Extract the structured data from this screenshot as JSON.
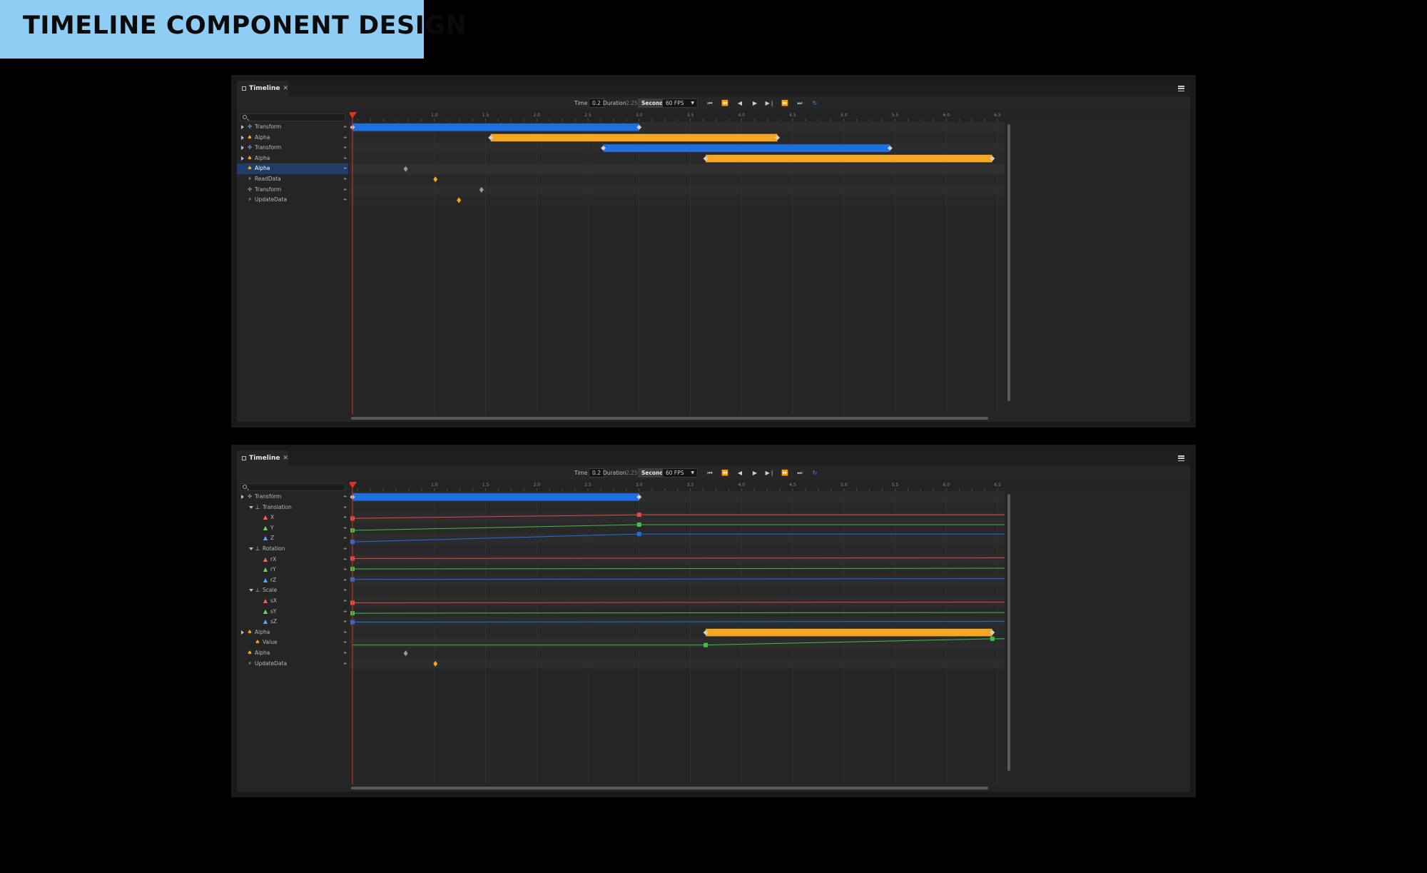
{
  "banner": {
    "title": "TIMELINE COMPONENT DESIGN"
  },
  "colors": {
    "blue_clip": "#1e6fe0",
    "orange_clip": "#f5a623",
    "playhead": "#e0301e",
    "curve_red": "#e14b4b",
    "curve_green": "#3fbf4a",
    "curve_blue": "#3c6fe0"
  },
  "panels": [
    {
      "tab_label": "Timeline",
      "toolbar": {
        "time_label": "Time",
        "time_value": "0.2",
        "duration_label": "Duration",
        "duration_value": "2.25",
        "units": "Seconds",
        "fps": "60 FPS"
      },
      "ruler_ticks": [
        "1.0",
        "1.5",
        "2.0",
        "2.5",
        "3.0",
        "3.5",
        "4.0",
        "4.5",
        "5.0",
        "5.5",
        "6.0",
        "6.5"
      ],
      "playhead_time": 0.2,
      "rows": [
        {
          "label": "Transform",
          "icon": "move-icon",
          "indent": 0,
          "caret": "right",
          "selected": false
        },
        {
          "label": "Alpha",
          "icon": "cup-icon",
          "indent": 0,
          "caret": "right",
          "selected": false
        },
        {
          "label": "Transform",
          "icon": "move-icon",
          "indent": 0,
          "caret": "right",
          "selected": false
        },
        {
          "label": "Alpha",
          "icon": "cup-icon",
          "indent": 0,
          "caret": "right",
          "selected": false
        },
        {
          "label": "Alpha",
          "icon": "cup-icon",
          "indent": 0,
          "caret": "none",
          "selected": true
        },
        {
          "label": "ReadData",
          "icon": "bolt-icon",
          "indent": 0,
          "caret": "none",
          "selected": false
        },
        {
          "label": "Transform",
          "icon": "move-icon",
          "indent": 0,
          "caret": "none",
          "selected": false
        },
        {
          "label": "UpdateData",
          "icon": "bolt-icon",
          "indent": 0,
          "caret": "none",
          "selected": false
        }
      ],
      "clips": [
        {
          "row": 0,
          "start": 0.2,
          "end": 3.0,
          "color": "blue"
        },
        {
          "row": 1,
          "start": 1.55,
          "end": 4.35,
          "color": "orange"
        },
        {
          "row": 2,
          "start": 2.65,
          "end": 5.45,
          "color": "blue"
        },
        {
          "row": 3,
          "start": 3.65,
          "end": 6.45,
          "color": "orange"
        }
      ],
      "keys": [
        {
          "row": 4,
          "time": 0.72,
          "color": "gray"
        },
        {
          "row": 5,
          "time": 1.01,
          "color": "orange"
        },
        {
          "row": 6,
          "time": 1.46,
          "color": "gray"
        },
        {
          "row": 7,
          "time": 1.24,
          "color": "orange"
        }
      ],
      "curves": []
    },
    {
      "tab_label": "Timeline",
      "toolbar": {
        "time_label": "Time",
        "time_value": "0.2",
        "duration_label": "Duration",
        "duration_value": "2.25",
        "units": "Seconds",
        "fps": "60 FPS"
      },
      "ruler_ticks": [
        "1.0",
        "1.5",
        "2.0",
        "2.5",
        "3.0",
        "3.5",
        "4.0",
        "4.5",
        "5.0",
        "5.5",
        "6.0",
        "6.5"
      ],
      "playhead_time": 0.2,
      "rows": [
        {
          "label": "Transform",
          "icon": "move-icon",
          "indent": 0,
          "caret": "right",
          "selected": false
        },
        {
          "label": "Translation",
          "icon": "axes-icon",
          "indent": 1,
          "caret": "down",
          "selected": false
        },
        {
          "label": "X",
          "icon": "tri-red-icon",
          "indent": 2,
          "caret": "none",
          "selected": false
        },
        {
          "label": "Y",
          "icon": "tri-green-icon",
          "indent": 2,
          "caret": "none",
          "selected": false
        },
        {
          "label": "Z",
          "icon": "tri-blue-icon",
          "indent": 2,
          "caret": "none",
          "selected": false
        },
        {
          "label": "Rotation",
          "icon": "axes-icon",
          "indent": 1,
          "caret": "down",
          "selected": false
        },
        {
          "label": "rX",
          "icon": "tri-red-icon",
          "indent": 2,
          "caret": "none",
          "selected": false
        },
        {
          "label": "rY",
          "icon": "tri-green-icon",
          "indent": 2,
          "caret": "none",
          "selected": false
        },
        {
          "label": "rZ",
          "icon": "tri-blue-icon",
          "indent": 2,
          "caret": "none",
          "selected": false
        },
        {
          "label": "Scale",
          "icon": "axes-icon",
          "indent": 1,
          "caret": "down",
          "selected": false
        },
        {
          "label": "sX",
          "icon": "tri-red-icon",
          "indent": 2,
          "caret": "none",
          "selected": false
        },
        {
          "label": "sY",
          "icon": "tri-green-icon",
          "indent": 2,
          "caret": "none",
          "selected": false
        },
        {
          "label": "sZ",
          "icon": "tri-blue-icon",
          "indent": 2,
          "caret": "none",
          "selected": false
        },
        {
          "label": "Alpha",
          "icon": "cup-icon",
          "indent": 0,
          "caret": "right",
          "selected": false
        },
        {
          "label": "Value",
          "icon": "cup-icon",
          "indent": 1,
          "caret": "none",
          "selected": false
        },
        {
          "label": "Alpha",
          "icon": "cup-icon",
          "indent": 0,
          "caret": "none",
          "selected": false
        },
        {
          "label": "UpdateData",
          "icon": "bolt-icon",
          "indent": 0,
          "caret": "none",
          "selected": false
        }
      ],
      "clips": [
        {
          "row": 0,
          "start": 0.2,
          "end": 3.0,
          "color": "blue"
        },
        {
          "row": 13,
          "start": 3.65,
          "end": 6.45,
          "color": "orange"
        }
      ],
      "keys": [
        {
          "row": 15,
          "time": 0.72,
          "color": "gray"
        },
        {
          "row": 16,
          "time": 1.01,
          "color": "orange"
        }
      ],
      "curves": [
        {
          "row": 2,
          "color": "red",
          "from": {
            "time": 0.2,
            "level": 0.45
          },
          "to": {
            "time": 3.0,
            "level": 0.8
          }
        },
        {
          "row": 3,
          "color": "green",
          "from": {
            "time": 0.2,
            "level": 0.3
          },
          "to": {
            "time": 3.0,
            "level": 0.85
          }
        },
        {
          "row": 4,
          "color": "blue",
          "from": {
            "time": 0.2,
            "level": 0.2
          },
          "to": {
            "time": 3.0,
            "level": 0.95
          }
        },
        {
          "row": 6,
          "color": "red",
          "from": {
            "time": 0.2,
            "level": 0.6
          },
          "to": null
        },
        {
          "row": 7,
          "color": "green",
          "from": {
            "time": 0.2,
            "level": 0.6
          },
          "to": null
        },
        {
          "row": 8,
          "color": "blue",
          "from": {
            "time": 0.2,
            "level": 0.6
          },
          "to": null
        },
        {
          "row": 10,
          "color": "red",
          "from": {
            "time": 0.2,
            "level": 0.35
          },
          "to": null
        },
        {
          "row": 11,
          "color": "green",
          "from": {
            "time": 0.2,
            "level": 0.35
          },
          "to": null
        },
        {
          "row": 12,
          "color": "blue",
          "from": {
            "time": 0.2,
            "level": 0.5
          },
          "to": null
        },
        {
          "row": 14,
          "color": "green",
          "from": {
            "time": 3.65,
            "level": 0.3
          },
          "to": {
            "time": 6.45,
            "level": 0.9
          },
          "pre": 0.3
        }
      ]
    }
  ]
}
